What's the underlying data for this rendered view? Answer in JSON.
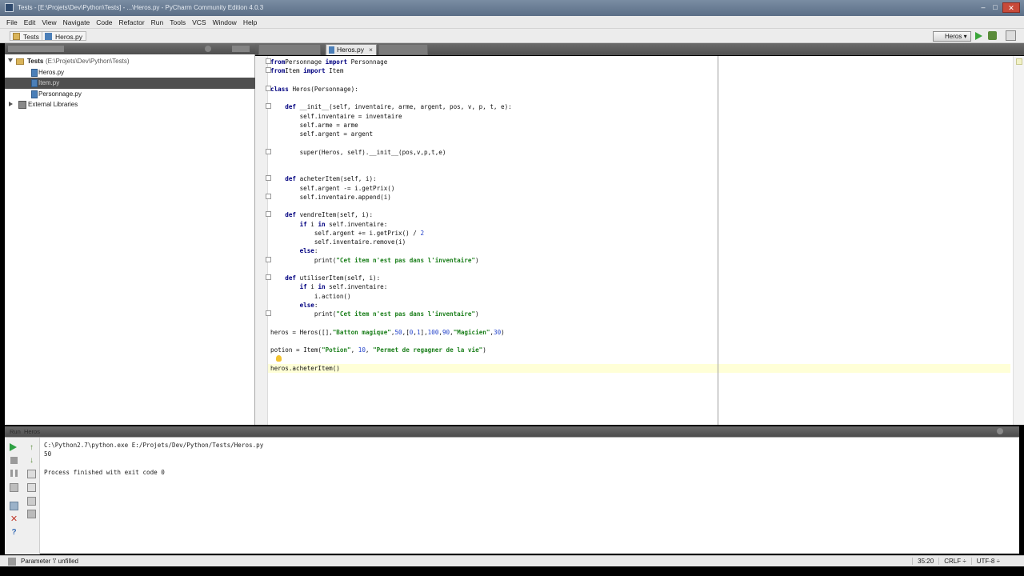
{
  "window": {
    "title": "Tests - [E:\\Projets\\Dev\\Python\\Tests] - ...\\Heros.py - PyCharm Community Edition 4.0.3"
  },
  "menu": [
    "File",
    "Edit",
    "View",
    "Navigate",
    "Code",
    "Refactor",
    "Run",
    "Tools",
    "VCS",
    "Window",
    "Help"
  ],
  "navbar": {
    "crumb1": "Tests",
    "crumb2": "Heros.py",
    "run_config": "Heros"
  },
  "project": {
    "root_label": "Tests",
    "root_path": "(E:\\Projets\\Dev\\Python\\Tests)",
    "files": [
      "Heros.py",
      "Item.py",
      "Personnage.py"
    ],
    "external": "External Libraries"
  },
  "editor": {
    "active_tab": "Heros.py",
    "tab_close": "×"
  },
  "code": [
    {
      "t": [
        [
          "kw",
          "from"
        ],
        [
          "",
          "Personnage "
        ],
        [
          "kw",
          "import"
        ],
        [
          "",
          " Personnage"
        ]
      ]
    },
    {
      "t": [
        [
          "kw",
          "from"
        ],
        [
          "",
          "Item "
        ],
        [
          "kw",
          "import"
        ],
        [
          "",
          " Item"
        ]
      ]
    },
    {
      "t": [
        [
          "",
          ""
        ]
      ]
    },
    {
      "t": [
        [
          "kw",
          "class "
        ],
        [
          "",
          "Heros(Personnage):"
        ]
      ]
    },
    {
      "t": [
        [
          "",
          ""
        ]
      ]
    },
    {
      "t": [
        [
          "kw",
          "    def "
        ],
        [
          "",
          "__init__(self, inventaire, arme, argent, pos, v, p, t, e):"
        ]
      ]
    },
    {
      "t": [
        [
          "",
          "        self.inventaire = inventaire"
        ]
      ]
    },
    {
      "t": [
        [
          "",
          "        self.arme = arme"
        ]
      ]
    },
    {
      "t": [
        [
          "",
          "        self.argent = argent"
        ]
      ]
    },
    {
      "t": [
        [
          "",
          ""
        ]
      ]
    },
    {
      "t": [
        [
          "",
          "        super(Heros, self).__init__(pos,v,p,t,e)"
        ]
      ]
    },
    {
      "t": [
        [
          "",
          ""
        ]
      ]
    },
    {
      "t": [
        [
          "",
          ""
        ]
      ]
    },
    {
      "t": [
        [
          "kw",
          "    def "
        ],
        [
          "",
          "acheterItem(self, i):"
        ]
      ]
    },
    {
      "t": [
        [
          "",
          "        self.argent -= i.getPrix()"
        ]
      ]
    },
    {
      "t": [
        [
          "",
          "        self.inventaire.append(i)"
        ]
      ]
    },
    {
      "t": [
        [
          "",
          ""
        ]
      ]
    },
    {
      "t": [
        [
          "kw",
          "    def "
        ],
        [
          "",
          "vendreItem(self, i):"
        ]
      ]
    },
    {
      "t": [
        [
          "kw",
          "        if "
        ],
        [
          "",
          "i "
        ],
        [
          "kw",
          "in"
        ],
        [
          "",
          " self.inventaire:"
        ]
      ]
    },
    {
      "t": [
        [
          "",
          "            self.argent += i.getPrix() / "
        ],
        [
          "num",
          "2"
        ]
      ]
    },
    {
      "t": [
        [
          "",
          "            self.inventaire.remove(i)"
        ]
      ]
    },
    {
      "t": [
        [
          "kw",
          "        else"
        ],
        [
          "",
          ":"
        ]
      ]
    },
    {
      "t": [
        [
          "",
          "            print("
        ],
        [
          "str",
          "\"Cet item n'est pas dans l'inventaire\""
        ],
        [
          "",
          ")"
        ]
      ]
    },
    {
      "t": [
        [
          "",
          ""
        ]
      ]
    },
    {
      "t": [
        [
          "kw",
          "    def "
        ],
        [
          "",
          "utiliserItem(self, i):"
        ]
      ]
    },
    {
      "t": [
        [
          "kw",
          "        if "
        ],
        [
          "",
          "i "
        ],
        [
          "kw",
          "in"
        ],
        [
          "",
          " self.inventaire:"
        ]
      ]
    },
    {
      "t": [
        [
          "",
          "            i.action()"
        ]
      ]
    },
    {
      "t": [
        [
          "kw",
          "        else"
        ],
        [
          "",
          ":"
        ]
      ]
    },
    {
      "t": [
        [
          "",
          "            print("
        ],
        [
          "str",
          "\"Cet item n'est pas dans l'inventaire\""
        ],
        [
          "",
          ")"
        ]
      ]
    },
    {
      "t": [
        [
          "",
          ""
        ]
      ]
    },
    {
      "t": [
        [
          "",
          "heros = Heros([],"
        ],
        [
          "str",
          "\"Batton magique\""
        ],
        [
          "",
          ","
        ],
        [
          "num",
          "50"
        ],
        [
          "",
          ",["
        ],
        [
          "num",
          "0"
        ],
        [
          "",
          ","
        ],
        [
          "num",
          "1"
        ],
        [
          "",
          "],"
        ],
        [
          "num",
          "100"
        ],
        [
          "",
          ","
        ],
        [
          "num",
          "90"
        ],
        [
          "",
          ","
        ],
        [
          "str",
          "\"Magicien\""
        ],
        [
          "",
          ","
        ],
        [
          "num",
          "30"
        ],
        [
          "",
          ")"
        ]
      ]
    },
    {
      "t": [
        [
          "",
          ""
        ]
      ]
    },
    {
      "t": [
        [
          "",
          "potion = Item("
        ],
        [
          "str",
          "\"Potion\""
        ],
        [
          "",
          ", "
        ],
        [
          "num",
          "10"
        ],
        [
          "",
          ", "
        ],
        [
          "str",
          "\"Permet de regagner de la vie\""
        ],
        [
          "",
          ")"
        ]
      ]
    },
    {
      "t": [
        [
          "",
          ""
        ]
      ]
    },
    {
      "t": [
        [
          "",
          "heros.acheterItem()"
        ]
      ]
    }
  ],
  "run": {
    "tab": "Run",
    "config": "Heros",
    "output": [
      "C:\\Python2.7\\python.exe E:/Projets/Dev/Python/Tests/Heros.py",
      "50",
      "",
      "Process finished with exit code 0"
    ]
  },
  "status": {
    "left": "Parameter 'i' unfilled",
    "position": "35:20",
    "line_sep": "CRLF ÷",
    "encoding": "UTF-8 ÷"
  }
}
